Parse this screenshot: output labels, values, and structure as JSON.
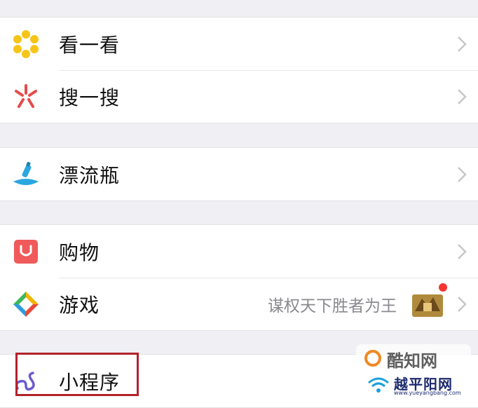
{
  "groups": [
    {
      "items": [
        {
          "label": "看一看",
          "icon": "sparkle-icon",
          "color": "#f5c518"
        },
        {
          "label": "搜一搜",
          "icon": "search-star-icon",
          "color": "#e64a4a"
        }
      ]
    },
    {
      "items": [
        {
          "label": "漂流瓶",
          "icon": "bottle-icon",
          "color": "#2aa7e0"
        }
      ]
    },
    {
      "items": [
        {
          "label": "购物",
          "icon": "shopping-bag-icon",
          "color": "#f05a5a"
        },
        {
          "label": "游戏",
          "icon": "game-icon",
          "detail": "谋权天下胜者为王",
          "has_badge": true
        }
      ]
    },
    {
      "items": [
        {
          "label": "小程序",
          "icon": "mini-program-icon",
          "color": "#6a5acd",
          "highlighted": true
        }
      ]
    }
  ],
  "watermarks": [
    {
      "text": "酷知网"
    },
    {
      "text": "越平阳网",
      "url": "www.yueyangbang.com"
    }
  ]
}
